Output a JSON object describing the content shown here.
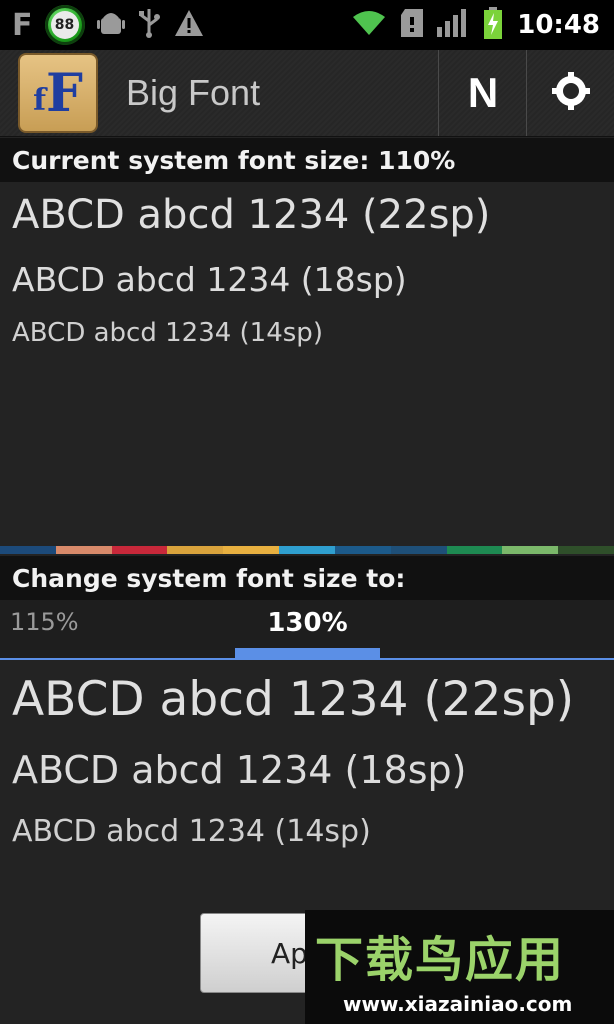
{
  "status_bar": {
    "left_letter": "F",
    "badge_number": "88",
    "icons": [
      "android-debug-icon",
      "usb-icon",
      "warning-icon"
    ],
    "right_icons": [
      "wifi-icon",
      "sdcard-icon",
      "signal-icon",
      "battery-charging-icon"
    ],
    "time": "10:48"
  },
  "action_bar": {
    "app_icon_letters": {
      "small": "f",
      "big": "F"
    },
    "title": "Big Font",
    "n_button_label": "N",
    "settings_icon": "gear-icon"
  },
  "current_section": {
    "header": "Current system font size: 110%",
    "samples": [
      "ABCD abcd 1234 (22sp)",
      "ABCD abcd 1234 (18sp)",
      "ABCD abcd 1234 (14sp)"
    ]
  },
  "color_strip": [
    "#1c4a7a",
    "#d88a6a",
    "#c8283a",
    "#d9a33c",
    "#e8b040",
    "#2f9fcf",
    "#1c5a8a",
    "#1e4f78",
    "#1e8a52",
    "#7bb86a",
    "#2f4f2a"
  ],
  "change_section": {
    "header": "Change system font size to:",
    "picker": {
      "left_option": "115%",
      "selected": "130%"
    },
    "samples": [
      "ABCD abcd 1234 (22sp)",
      "ABCD abcd 1234 (18sp)",
      "ABCD abcd 1234 (14sp)"
    ]
  },
  "apply_button_label": "Ap",
  "watermark": {
    "main": "下载鸟应用",
    "url": "www.xiazainiao.com"
  }
}
